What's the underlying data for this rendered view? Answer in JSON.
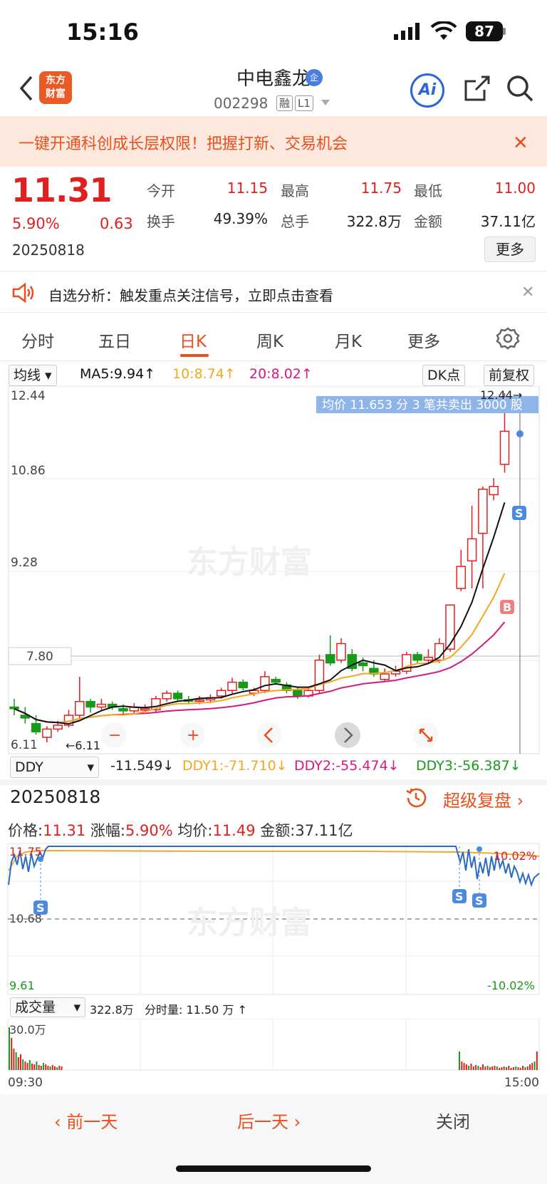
{
  "status_bar": {
    "time": "15:16",
    "battery": "87"
  },
  "header": {
    "logo": "东方财富",
    "stock_name": "中电鑫龙",
    "badge": "企",
    "code": "002298",
    "tag_margin": "融",
    "tag_level": "L1",
    "ai_label": "Ai"
  },
  "banner": {
    "text": "一键开通科创成长层权限！把握打新、交易机会"
  },
  "quote": {
    "price": "11.31",
    "change_pct": "5.90%",
    "change": "0.63",
    "date": "20250818",
    "open_label": "今开",
    "open": "11.15",
    "high_label": "最高",
    "high": "11.75",
    "low_label": "最低",
    "low": "11.00",
    "turnover_label": "换手",
    "turnover": "49.39%",
    "volume_label": "总手",
    "volume": "322.8万",
    "amount_label": "金额",
    "amount": "37.11亿",
    "more": "更多"
  },
  "analysis": {
    "text": "自选分析：触发重点关注信号，立即点击查看"
  },
  "tabs": [
    "分时",
    "五日",
    "日K",
    "周K",
    "月K",
    "更多"
  ],
  "ma_bar": {
    "selector": "均线",
    "ma5": "MA5:9.94",
    "ma10": "10:8.74",
    "ma20": "20:8.02",
    "dk": "DK点",
    "adjust": "前复权"
  },
  "kline": {
    "y_labels": [
      "12.44",
      "10.86",
      "9.28",
      "7.80",
      "6.11"
    ],
    "tooltip": "均价 11.653 分 3 笔共卖出 3000 股",
    "high_marker": "12.44",
    "low_marker": "6.11",
    "watermark": "东方财富",
    "signal_s": "S",
    "signal_b": "B"
  },
  "ddy_bar": {
    "selector": "DDY",
    "ddy": "-11.549",
    "ddy1": "DDY1:-71.710",
    "ddy2": "DDY2:-55.474",
    "ddy3": "DDY3:-56.387"
  },
  "intraday": {
    "date": "20250818",
    "replay": "超级复盘",
    "price_label": "价格:",
    "price": "11.31",
    "pct_label": "涨幅:",
    "pct": "5.90%",
    "avg_label": "均价:",
    "avg": "11.49",
    "amt_label": "金额:",
    "amt": "37.11亿",
    "y_top": "11.75",
    "y_mid": "10.68",
    "y_bot": "9.61",
    "pct_top": "10.02%",
    "pct_bot": "-10.02%",
    "time_start": "09:30",
    "time_end": "15:00"
  },
  "volume_bar": {
    "selector": "成交量",
    "total": "322.8万",
    "minute": "分时量: 11.50 万",
    "axis": "30.0万"
  },
  "footer": {
    "prev": "前一天",
    "next": "后一天",
    "close": "关闭"
  },
  "colors": {
    "up": "#e02020",
    "down": "#1a9a1a",
    "accent": "#e8501e",
    "ma5": "#111111",
    "ma10": "#f5a623",
    "ma20": "#d6197e",
    "price_line": "#2a6bc4"
  }
}
